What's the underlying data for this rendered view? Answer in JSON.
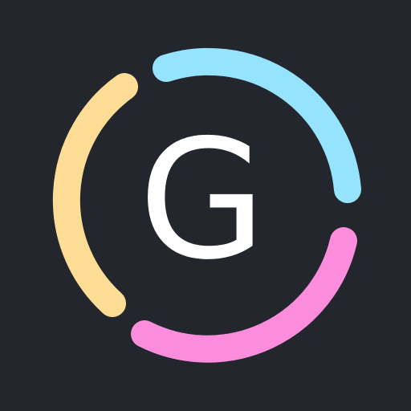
{
  "icon": {
    "letter": "G",
    "background_color": "#23272d",
    "letter_color": "#ffffff",
    "ring_segments": [
      {
        "name": "yellow-arc",
        "color": "#fddc95"
      },
      {
        "name": "blue-arc",
        "color": "#96e3fd"
      },
      {
        "name": "pink-arc",
        "color": "#fc8ddc"
      }
    ]
  }
}
